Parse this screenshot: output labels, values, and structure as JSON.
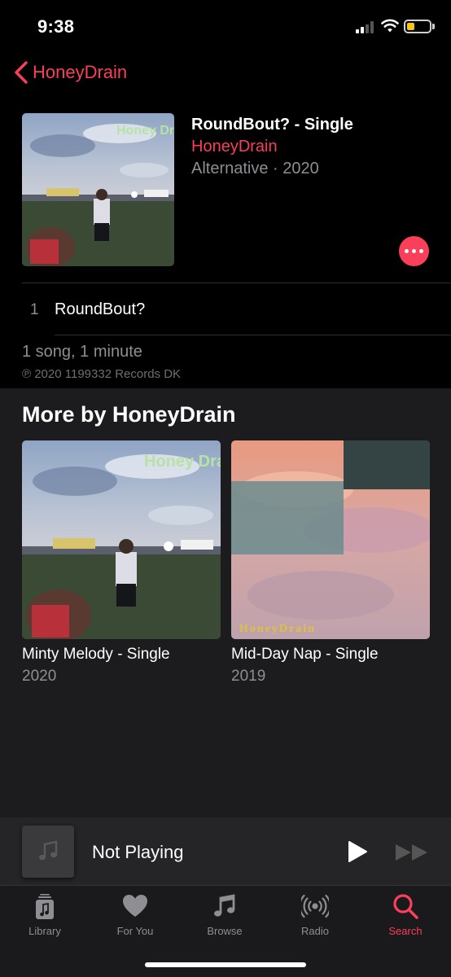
{
  "status_bar": {
    "time": "9:38"
  },
  "nav": {
    "back_label": "HoneyDrain"
  },
  "album": {
    "title": "RoundBout? - Single",
    "artist": "HoneyDrain",
    "meta": "Alternative · 2020",
    "cover_text": "Honey Drain"
  },
  "tracks": [
    {
      "number": "1",
      "title": "RoundBout?"
    }
  ],
  "summary": {
    "song_count": "1 song, 1 minute",
    "copyright": "℗ 2020 1199332 Records DK"
  },
  "more_by": {
    "title": "More by HoneyDrain",
    "items": [
      {
        "title": "Minty Melody - Single",
        "year": "2020",
        "cover_text": "Honey Drain"
      },
      {
        "title": "Mid-Day Nap - Single",
        "year": "2019",
        "cover_text": "HoneyDrain"
      }
    ]
  },
  "mini_player": {
    "title": "Not Playing"
  },
  "tabs": [
    {
      "label": "Library",
      "icon": "library-icon"
    },
    {
      "label": "For You",
      "icon": "heart-icon"
    },
    {
      "label": "Browse",
      "icon": "music-note-icon"
    },
    {
      "label": "Radio",
      "icon": "radio-icon"
    },
    {
      "label": "Search",
      "icon": "search-icon"
    }
  ],
  "colors": {
    "accent": "#fa3f5b",
    "background": "#000000",
    "section_bg": "#1c1c1e",
    "secondary_text": "#8e8e93"
  }
}
